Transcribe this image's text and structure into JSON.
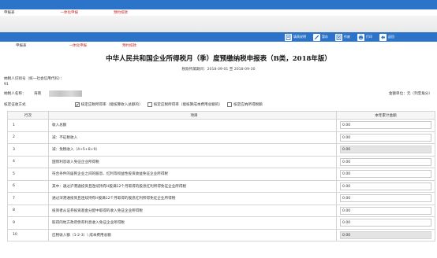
{
  "toolbar": {
    "buttons": [
      {
        "label": "填表说明",
        "icon": "document-icon"
      },
      {
        "label": "暂存",
        "icon": "pencil-icon"
      },
      {
        "label": "作废",
        "icon": "cancel-doc-icon"
      },
      {
        "label": "打印",
        "icon": "printer-icon"
      },
      {
        "label": "返回",
        "icon": "back-arrow-icon"
      }
    ]
  },
  "tabs": [
    {
      "label": "申报表"
    },
    {
      "label": "一体化申报"
    },
    {
      "label": "预约扣款"
    }
  ],
  "form": {
    "title": "中华人民共和国企业所得税月（季）度预缴纳税申报表（B类，2018年版）",
    "period": "税款所属期间：2018-09-01 至 2018-09-30",
    "taxpayer_id_label": "纳税人识别号（统一社会信用代码）：",
    "taxpayer_id_value": "91",
    "taxpayer_name_label": "纳税人名称：",
    "taxpayer_name_value": "海南",
    "unit": "金额单位：元（列至角分）",
    "method_label": "核定征收方式",
    "methods": [
      {
        "label": "核定应税所得率（能核算收入总额的）",
        "checked": true
      },
      {
        "label": "核定应税所得率（能核算成本费用总额的）",
        "checked": false
      },
      {
        "label": "核定应纳所得税额",
        "checked": false
      }
    ]
  },
  "table": {
    "headers": {
      "line": "行次",
      "item": "项目",
      "amount": "本年累计金额"
    },
    "rows": [
      {
        "line": "1",
        "item": "收入总额",
        "amount": "0.00",
        "disabled": false,
        "indent": 0
      },
      {
        "line": "2",
        "item": "减：不征税收入",
        "amount": "0.00",
        "disabled": false,
        "indent": 0
      },
      {
        "line": "3",
        "item": "减：免税收入（4+5+8+9）",
        "amount": "0.00",
        "disabled": true,
        "indent": 0
      },
      {
        "line": "4",
        "item": "国债利息收入免征企业所得税",
        "amount": "0.00",
        "disabled": false,
        "indent": 1
      },
      {
        "line": "5",
        "item": "符合条件的居民企业之间的股息、红利等权益性投资收益免征企业所得税",
        "amount": "0.00",
        "disabled": false,
        "indent": 1
      },
      {
        "line": "6",
        "item": "其中：通过沪港通投资且连续持有H股满12个月取得的股息红利所得免征企业所得税",
        "amount": "0.00",
        "disabled": false,
        "indent": 1
      },
      {
        "line": "7",
        "item": "通过深港通投资且连续持有H股满12个月取得的股息红利所得免征企业所得税",
        "amount": "0.00",
        "disabled": false,
        "indent": 2
      },
      {
        "line": "8",
        "item": "投资者从证券投资基金分配中取得的收入免征企业所得税",
        "amount": "0.00",
        "disabled": false,
        "indent": 1
      },
      {
        "line": "9",
        "item": "取得的地方政府债券利息收入免征企业所得税",
        "amount": "0.00",
        "disabled": false,
        "indent": 1
      },
      {
        "line": "10",
        "item": "应税收入额（1-2-3）\\ 成本费用总额",
        "amount": "0.00",
        "disabled": true,
        "indent": 0
      }
    ]
  }
}
